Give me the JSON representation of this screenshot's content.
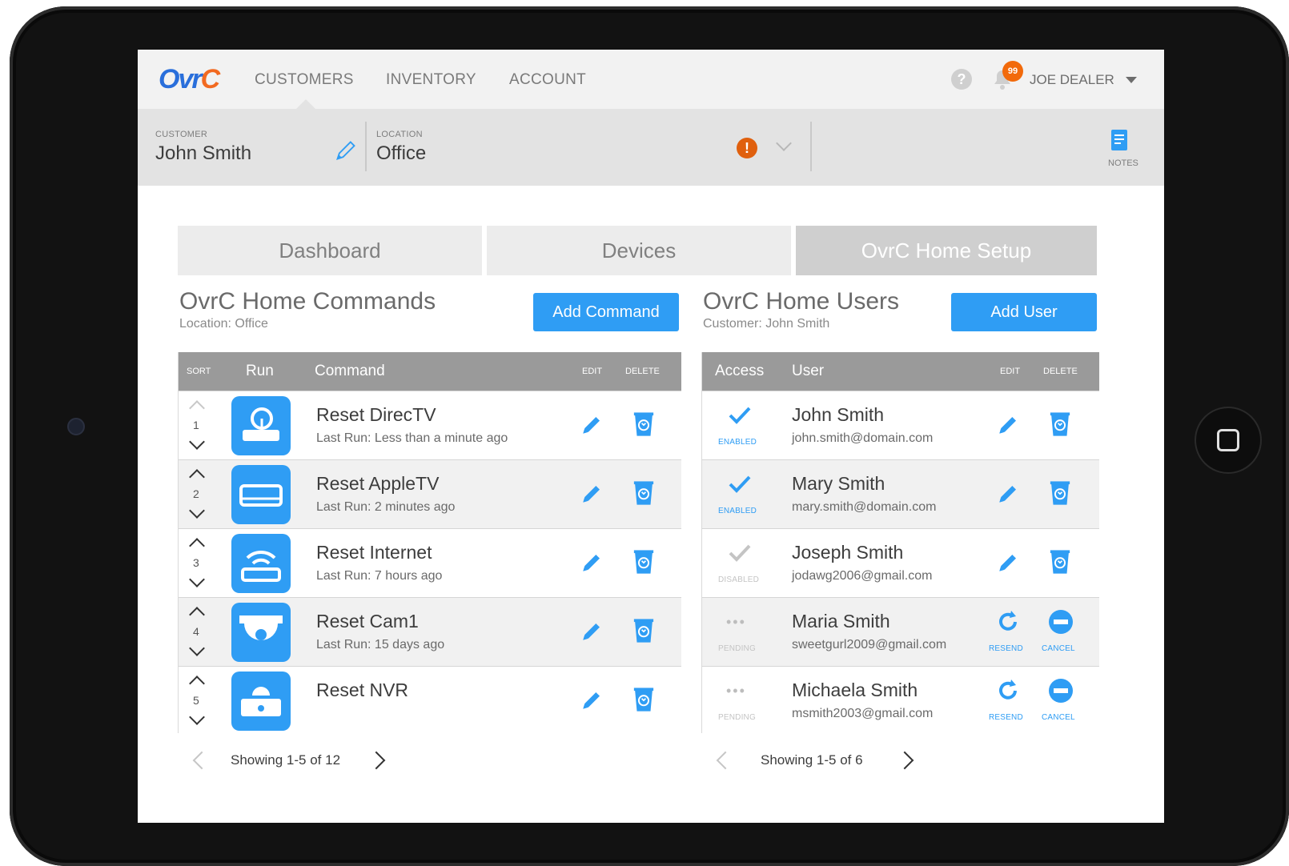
{
  "nav": {
    "logo": "OvrC",
    "links": [
      "CUSTOMERS",
      "INVENTORY",
      "ACCOUNT"
    ],
    "notification_count": "99",
    "user": "JOE DEALER"
  },
  "customer_bar": {
    "customer_label": "CUSTOMER",
    "customer_name": "John Smith",
    "location_label": "LOCATION",
    "location_name": "Office",
    "notes_label": "NOTES"
  },
  "tabs": [
    "Dashboard",
    "Devices",
    "OvrC Home Setup"
  ],
  "commands": {
    "title": "OvrC Home Commands",
    "subtitle": "Location: Office",
    "add_button": "Add Command",
    "headers": {
      "sort": "SORT",
      "run": "Run",
      "command": "Command",
      "edit": "EDIT",
      "delete": "DELETE"
    },
    "rows": [
      {
        "sort": "1",
        "name": "Reset DirecTV",
        "last_run": "Last Run: Less than a minute ago",
        "icon": "satellite-receiver-icon"
      },
      {
        "sort": "2",
        "name": "Reset AppleTV",
        "last_run": "Last Run: 2 minutes ago",
        "icon": "media-box-icon"
      },
      {
        "sort": "3",
        "name": "Reset Internet",
        "last_run": "Last Run: 7 hours ago",
        "icon": "wifi-router-icon"
      },
      {
        "sort": "4",
        "name": "Reset Cam1",
        "last_run": "Last Run: 15 days ago",
        "icon": "dome-camera-icon"
      },
      {
        "sort": "5",
        "name": "Reset NVR",
        "last_run": "",
        "icon": "nvr-icon"
      }
    ],
    "pagination": "Showing 1-5 of 12"
  },
  "users": {
    "title": "OvrC Home Users",
    "subtitle": "Customer: John Smith",
    "add_button": "Add User",
    "headers": {
      "access": "Access",
      "user": "User",
      "edit": "EDIT",
      "delete": "DELETE"
    },
    "rows": [
      {
        "status": "ENABLED",
        "name": "John Smith",
        "email": "john.smith@domain.com",
        "actions": "edit"
      },
      {
        "status": "ENABLED",
        "name": "Mary Smith",
        "email": "mary.smith@domain.com",
        "actions": "edit"
      },
      {
        "status": "DISABLED",
        "name": "Joseph Smith",
        "email": "jodawg2006@gmail.com",
        "actions": "edit"
      },
      {
        "status": "PENDING",
        "name": "Maria Smith",
        "email": "sweetgurl2009@gmail.com",
        "actions": "pending",
        "resend": "RESEND",
        "cancel": "CANCEL"
      },
      {
        "status": "PENDING",
        "name": "Michaela Smith",
        "email": "msmith2003@gmail.com",
        "actions": "pending",
        "resend": "RESEND",
        "cancel": "CANCEL"
      }
    ],
    "pagination": "Showing 1-5 of 6"
  },
  "colors": {
    "accent": "#2f9df4",
    "alert": "#e0600e",
    "header": "#9a9a9a"
  }
}
